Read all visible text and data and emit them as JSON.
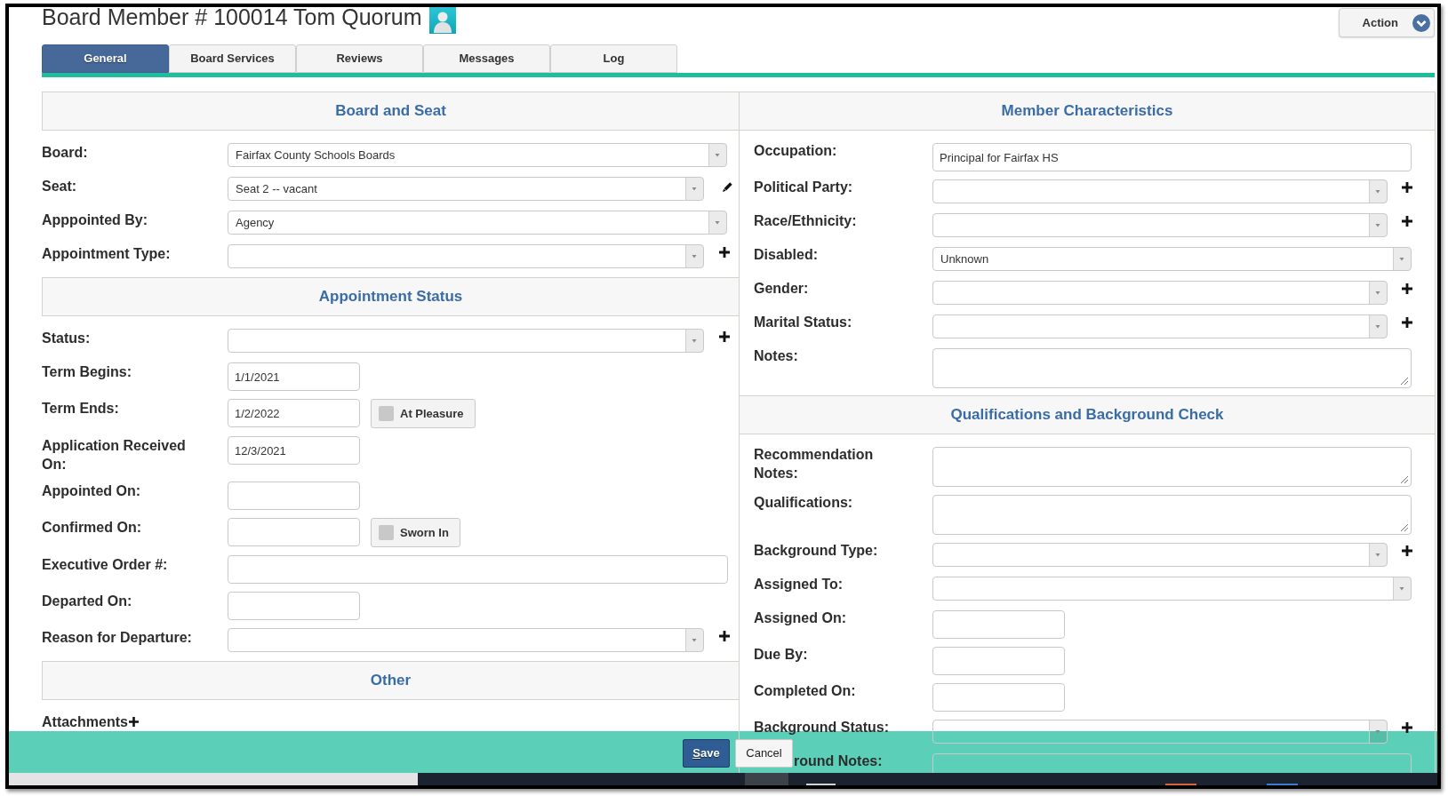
{
  "window": {
    "title": "Board Member # 100014 Tom Quorum"
  },
  "action_menu": {
    "label": "Action"
  },
  "tabs": [
    {
      "label": "General",
      "selected": true
    },
    {
      "label": "Board Services",
      "selected": false
    },
    {
      "label": "Reviews",
      "selected": false
    },
    {
      "label": "Messages",
      "selected": false
    },
    {
      "label": "Log",
      "selected": false
    }
  ],
  "left_panel": {
    "sections": [
      {
        "title": "Board and Seat",
        "fields": [
          {
            "label": "Board:",
            "kind": "dropdown",
            "value": "Fairfax County Schools Boards"
          },
          {
            "label": "Seat:",
            "kind": "dropdown",
            "value": "Seat 2 -- vacant",
            "edit_button": true
          },
          {
            "label": "Apppointed By:",
            "kind": "dropdown",
            "value": "Agency"
          },
          {
            "label": "Appointment Type:",
            "kind": "dropdown",
            "add_button": true
          }
        ]
      },
      {
        "title": "Appointment Status",
        "fields": [
          {
            "label": "Status:",
            "kind": "dropdown",
            "add_button": true
          },
          {
            "label": "Term Begins:",
            "kind": "date",
            "value": "1/1/2021"
          },
          {
            "label": "Term Ends:",
            "kind": "date",
            "value": "1/2/2022",
            "toggle": {
              "label": "At Pleasure",
              "checked": false
            }
          },
          {
            "label": "Application Received On:",
            "kind": "date",
            "value": "12/3/2021"
          },
          {
            "label": "Appointed On:",
            "kind": "date"
          },
          {
            "label": "Confirmed On:",
            "kind": "date",
            "toggle": {
              "label": "Sworn In",
              "checked": false
            }
          },
          {
            "label": "Executive Order #:",
            "kind": "text"
          },
          {
            "label": "Departed On:",
            "kind": "date"
          },
          {
            "label": "Reason for Departure:",
            "kind": "dropdown",
            "add_button": true
          }
        ]
      },
      {
        "title": "Other",
        "fields": [
          {
            "label": "Attachments",
            "kind": "attachments",
            "add_button": true
          }
        ]
      }
    ]
  },
  "right_panel": {
    "sections": [
      {
        "title": "Member Characteristics",
        "fields": [
          {
            "label": "Occupation:",
            "kind": "text",
            "value": "Principal for Fairfax HS"
          },
          {
            "label": "Political Party:",
            "kind": "dropdown",
            "add_button": true
          },
          {
            "label": "Race/Ethnicity:",
            "kind": "dropdown",
            "add_button": true
          },
          {
            "label": "Disabled:",
            "kind": "dropdown",
            "value": "Unknown"
          },
          {
            "label": "Gender:",
            "kind": "dropdown",
            "add_button": true
          },
          {
            "label": "Marital Status:",
            "kind": "dropdown",
            "add_button": true
          },
          {
            "label": "Notes:",
            "kind": "textarea"
          }
        ]
      },
      {
        "title": "Qualifications and Background Check",
        "fields": [
          {
            "label": "Recommendation Notes:",
            "kind": "textarea"
          },
          {
            "label": "Qualifications:",
            "kind": "textarea"
          },
          {
            "label": "Background Type:",
            "kind": "dropdown",
            "add_button": true
          },
          {
            "label": "Assigned To:",
            "kind": "dropdown"
          },
          {
            "label": "Assigned On:",
            "kind": "date"
          },
          {
            "label": "Due By:",
            "kind": "date"
          },
          {
            "label": "Completed On:",
            "kind": "date"
          },
          {
            "label": "Background Status:",
            "kind": "dropdown",
            "add_button": true
          },
          {
            "label": "round Notes:",
            "kind": "textarea",
            "partly_hidden": true
          }
        ]
      }
    ]
  },
  "footer": {
    "buttons": [
      {
        "label": "Save",
        "kind": "primary",
        "mnemonic": true
      },
      {
        "label": "Cancel",
        "kind": "secondary",
        "mnemonic": false
      }
    ]
  }
}
